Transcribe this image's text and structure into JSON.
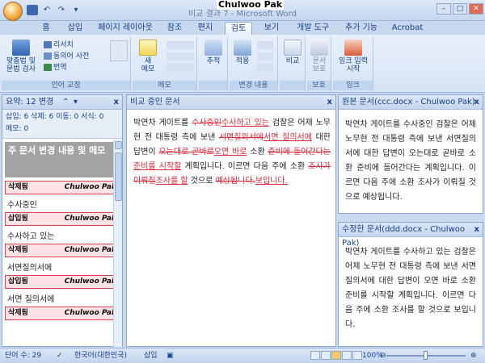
{
  "title": {
    "doc_title": "비교 결과 7 - Microsoft Word",
    "overlay": "Chulwoo Pak"
  },
  "tabs": [
    "홈",
    "삽입",
    "페이지 레이아웃",
    "참조",
    "편지",
    "검토",
    "보기",
    "개발 도구",
    "추가 기능",
    "Acrobat"
  ],
  "active_tab": "검토",
  "ribbon": {
    "proofing": {
      "spell": "맞춤법 및\n문법 검사",
      "research": "리서치",
      "thesaurus": "동의어 사전",
      "translate": "번역",
      "label": "언어 교정"
    },
    "comments": {
      "new": "새\n메모",
      "label": "메모"
    },
    "tracking": {
      "track": "추적",
      "label": ""
    },
    "changes": {
      "accept": "적용",
      "label": "변경 내용"
    },
    "compare": {
      "compare": "비교",
      "label": ""
    },
    "protect": {
      "protect": "문서\n보호",
      "label": "보호"
    },
    "ink": {
      "start": "잉크 입력\n시작",
      "label": "잉크"
    }
  },
  "left_pane": {
    "header": "요약: 12 변경",
    "stats1": "삽입: 6 삭제: 6 이동: 0 서식: 0",
    "stats2": "메모: 0",
    "summary": "주 문서 변경 내용 및 메모",
    "revisions": [
      {
        "type": "삭제됨",
        "author": "Chulwoo Pak",
        "text": "수사중인"
      },
      {
        "type": "삽입됨",
        "author": "Chulwoo Pak",
        "text": "수사하고 있는"
      },
      {
        "type": "삭제됨",
        "author": "Chulwoo Pak",
        "text": "서면질의서에"
      },
      {
        "type": "삽입됨",
        "author": "Chulwoo Pak",
        "text": "서면 질의서에"
      },
      {
        "type": "삭제됨",
        "author": "Chulwoo Pak",
        "text": ""
      }
    ]
  },
  "center_pane": {
    "header": "비교 중인 문서",
    "seg1": "박연차 게이트를 ",
    "del1": "수사중인",
    "ins1": "수사하고 있는",
    "seg2": " 검찰은 어제 노무현 전 대통령 측에 보낸 ",
    "del2": "서면질의서에",
    "ins2": "서면 질의서에",
    "seg3": " 대한 답변이 ",
    "del3": "오는대로 곧바로",
    "ins3": "오면 바로",
    "seg4": " 소환 ",
    "del4": "준비에 들어간다는",
    "ins4": "준비를 시작할",
    "seg5": " 계획입니다. 이르면 다음 주에 소환 ",
    "del5": "조사가 이뤄질",
    "ins5": "조사를 할",
    "seg6": " 것으로 ",
    "del6": "예상됩니다.",
    "ins6": "보입니다."
  },
  "original_pane": {
    "header": "원본 문서(ccc.docx - Chulwoo Pak)",
    "text": "박연차 게이트를 수사중인 검찰은 어제 노무현 전 대통령 측에 보낸 서면질의서에 대한 답변이 오는대로 곧바로 소환 준비에 들어간다는 계획입니다. 이르면 다음 주에 소환 조사가 이뤄질 것으로 예상됩니다."
  },
  "revised_pane": {
    "header": "수정한 문서(ddd.docx - Chulwoo Pak)",
    "text": "박연차 게이트를 수사하고 있는 검찰은 어제 노무현 전 대통령 측에 보낸 서면 질의서에 대한 답변이 오면 바로 소환 준비를 시작할 계획입니다. 이르면 다음 주에 소환 조사를 할 것으로 보입니다."
  },
  "status": {
    "words": "단어 수: 29",
    "lang": "한국어(대한민국)",
    "mode": "삽입",
    "zoom": "100%"
  }
}
